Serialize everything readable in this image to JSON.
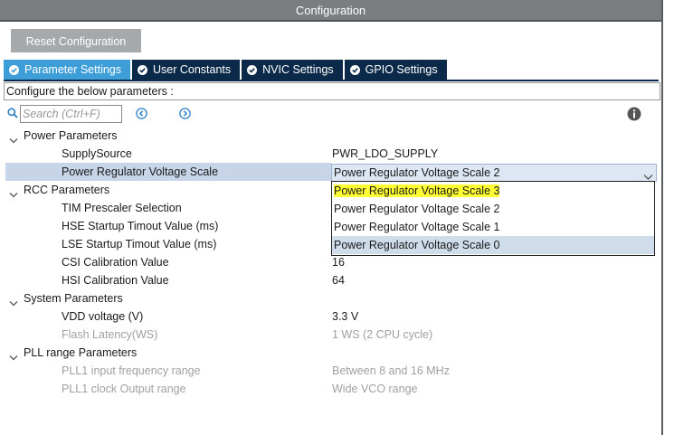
{
  "window": {
    "title": "Configuration"
  },
  "toolbar": {
    "reset_label": "Reset Configuration"
  },
  "tabs": [
    {
      "label": "Parameter Settings",
      "active": true
    },
    {
      "label": "User Constants",
      "active": false
    },
    {
      "label": "NVIC Settings",
      "active": false
    },
    {
      "label": "GPIO Settings",
      "active": false
    }
  ],
  "configure_text": "Configure the below parameters :",
  "search": {
    "placeholder": "Search (Ctrl+F)"
  },
  "groups": {
    "power": {
      "label": "Power Parameters",
      "supply_source": {
        "label": "SupplySource",
        "value": "PWR_LDO_SUPPLY"
      },
      "voltage_scale": {
        "label": "Power Regulator Voltage Scale",
        "value": "Power Regulator Voltage Scale 2"
      }
    },
    "rcc": {
      "label": "RCC Parameters",
      "tim_prescaler": {
        "label": "TIM Prescaler Selection"
      },
      "hse_timeout": {
        "label": "HSE Startup Timout Value (ms)"
      },
      "lse_timeout": {
        "label": "LSE Startup Timout Value (ms)"
      },
      "csi_calibration": {
        "label": "CSI Calibration Value",
        "value": "16"
      },
      "hsi_calibration": {
        "label": "HSI Calibration Value",
        "value": "64"
      }
    },
    "system": {
      "label": "System Parameters",
      "vdd_voltage": {
        "label": "VDD voltage (V)",
        "value": "3.3 V"
      },
      "flash_latency": {
        "label": "Flash Latency(WS)",
        "value": "1 WS (2 CPU cycle)"
      }
    },
    "pll": {
      "label": "PLL range Parameters",
      "pll1_input": {
        "label": "PLL1 input frequency range",
        "value": "Between 8 and 16 MHz"
      },
      "pll1_output": {
        "label": "PLL1 clock Output range",
        "value": "Wide VCO range"
      }
    }
  },
  "dropdown_options": [
    "Power Regulator Voltage Scale 3",
    "Power Regulator Voltage Scale 2",
    "Power Regulator Voltage Scale 1",
    "Power Regulator Voltage Scale 0"
  ],
  "colors": {
    "active_tab": "#3d9ed8",
    "inactive_tab": "#0b2949",
    "highlight": "#ffff33",
    "selection": "#c8d4e8"
  }
}
